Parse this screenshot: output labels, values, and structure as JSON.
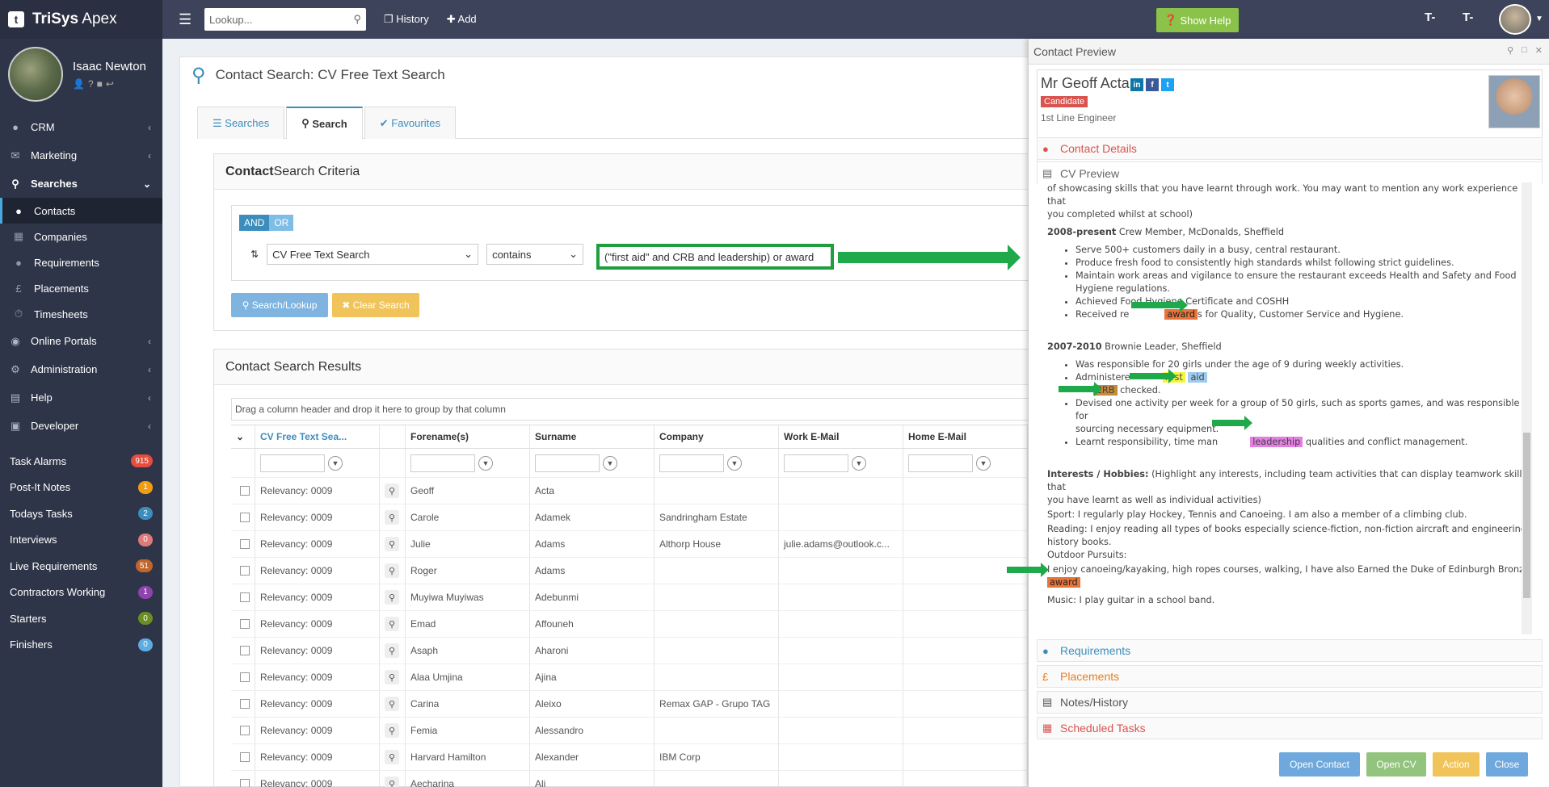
{
  "app": {
    "brand_short": "t",
    "brand_name": "TriSys",
    "brand_suffix": " Apex"
  },
  "user": {
    "name": "Isaac Newton"
  },
  "nav": {
    "items": [
      {
        "label": "CRM",
        "icon": "users-icon"
      },
      {
        "label": "Marketing",
        "icon": "envelope-icon"
      },
      {
        "label": "Searches",
        "icon": "search-icon"
      }
    ],
    "sub": [
      {
        "label": "Contacts"
      },
      {
        "label": "Companies"
      },
      {
        "label": "Requirements"
      },
      {
        "label": "Placements"
      },
      {
        "label": "Timesheets"
      }
    ],
    "more": [
      {
        "label": "Online Portals"
      },
      {
        "label": "Administration"
      },
      {
        "label": "Help"
      },
      {
        "label": "Developer"
      }
    ]
  },
  "alarms": [
    {
      "label": "Task Alarms",
      "count": "915",
      "color": "#e74c3c"
    },
    {
      "label": "Post-It Notes",
      "count": "1",
      "color": "#f39c12"
    },
    {
      "label": "Todays Tasks",
      "count": "2",
      "color": "#3c8dbc"
    },
    {
      "label": "Interviews",
      "count": "0",
      "color": "#e07a7a"
    },
    {
      "label": "Live Requirements",
      "count": "51",
      "color": "#c0662b"
    },
    {
      "label": "Contractors Working",
      "count": "1",
      "color": "#8e44ad"
    },
    {
      "label": "Starters",
      "count": "0",
      "color": "#6b8e23"
    },
    {
      "label": "Finishers",
      "count": "0",
      "color": "#5dade2"
    }
  ],
  "topbar": {
    "lookup_placeholder": "Lookup...",
    "history": "History",
    "add": "Add",
    "show_help": "Show Help",
    "t_minus": "T-",
    "t_plus": "T-"
  },
  "page": {
    "title": "Contact Search: CV Free Text Search",
    "tabs": [
      "Searches",
      "Search",
      "Favourites"
    ],
    "criteria_title_bold": "Contact",
    "criteria_title": " Search Criteria",
    "and": "AND",
    "or": "OR",
    "field": "CV Free Text Search",
    "operator": "contains",
    "value": "(\"first aid\" and CRB and leadership) or award",
    "search_btn": "Search/Lookup",
    "clear_btn": "Clear Search",
    "results_title": "Contact Search Results",
    "group_hint": "Drag a column header and drop it here to group by that column"
  },
  "grid": {
    "columns": [
      "CV Free Text Sea...",
      "Forename(s)",
      "Surname",
      "Company",
      "Work E-Mail",
      "Home E-Mail"
    ],
    "rows": [
      [
        "Relevancy: 0009",
        "Geoff",
        "Acta",
        "",
        "",
        ""
      ],
      [
        "Relevancy: 0009",
        "Carole",
        "Adamek",
        "Sandringham Estate",
        "",
        ""
      ],
      [
        "Relevancy: 0009",
        "Julie",
        "Adams",
        "Althorp House",
        "julie.adams@outlook.c...",
        ""
      ],
      [
        "Relevancy: 0009",
        "Roger",
        "Adams",
        "",
        "",
        ""
      ],
      [
        "Relevancy: 0009",
        "Muyiwa Muyiwas",
        "Adebunmi",
        "",
        "",
        ""
      ],
      [
        "Relevancy: 0009",
        "Emad",
        "Affouneh",
        "",
        "",
        ""
      ],
      [
        "Relevancy: 0009",
        "Asaph",
        "Aharoni",
        "",
        "",
        ""
      ],
      [
        "Relevancy: 0009",
        "Alaa Umjina",
        "Ajina",
        "",
        "",
        ""
      ],
      [
        "Relevancy: 0009",
        "Carina",
        "Aleixo",
        "Remax GAP - Grupo TAG",
        "",
        ""
      ],
      [
        "Relevancy: 0009",
        "Femia",
        "Alessandro",
        "",
        "",
        ""
      ],
      [
        "Relevancy: 0009",
        "Harvard Hamilton",
        "Alexander",
        "IBM Corp",
        "",
        ""
      ],
      [
        "Relevancy: 0009",
        "Aecharina",
        "Ali",
        "",
        "",
        ""
      ]
    ]
  },
  "preview": {
    "title": "Contact Preview",
    "name": "Mr Geoff Acta",
    "badge": "Candidate",
    "job": "1st Line Engineer",
    "sections": [
      "Contact Details",
      "CV Preview",
      "Requirements",
      "Placements",
      "Notes/History",
      "Scheduled Tasks"
    ],
    "buttons": [
      "Open Contact",
      "Open CV",
      "Action",
      "Close"
    ]
  },
  "cv": {
    "l1": "of showcasing skills that you have learnt through work.  You may want to mention any work experience that",
    "l2": "you completed whilst at school)",
    "job1_date": "2008-present",
    "job1_title": " Crew Member, McDonalds, Sheffield",
    "job1_items": [
      "Serve 500+ customers daily in a busy, central restaurant.",
      "Produce fresh food to consistently high standards whilst following strict guidelines.",
      "Maintain work areas and vigilance to ensure the restaurant exceeds Health and Safety and Food",
      "Hygiene regulations.",
      "Achieved Food Hygiene Certificate and COSHH"
    ],
    "received_a": "Received re",
    "award": "award",
    "received_b": "s for Quality, Customer Service and Hygiene.",
    "job2_date": "2007-2010",
    "job2_title": " Brownie Leader, Sheffield",
    "job2_i1": "Was responsible for 20 girls under the age of 9 during weekly activities.",
    "admin": "Administere",
    "first": "first",
    "aid": "aid",
    "crb": "CRB",
    "checked": " checked.",
    "job2_i3": "Devised one activity per week for a group of 50 girls, such as sports games, and was responsible for",
    "job2_i3b": "sourcing necessary equipment.",
    "learnt": "Learnt responsibility, time man",
    "leadership": "leadership",
    "learnt_b": " qualities and conflict management.",
    "int_bold": "Interests / Hobbies:",
    "int_rest": " (Highlight any interests, including team activities that can display teamwork skills that",
    "int_l2": "you have learnt as well as individual activities)",
    "sport": "Sport: I regularly play Hockey, Tennis and Canoeing. I am also a member of a climbing club.",
    "reading": "Reading: I enjoy reading all types of books especially science-fiction, non-fiction aircraft and engineering",
    "reading2": "history books.",
    "outdoor": "Outdoor Pursuits:",
    "outdoor2": "I enjoy canoeing/kayaking, high ropes courses, walking, I have also Earned the Duke of Edinburgh Bronze",
    "award2": "award",
    "music": "Music: I play guitar in a school band."
  }
}
